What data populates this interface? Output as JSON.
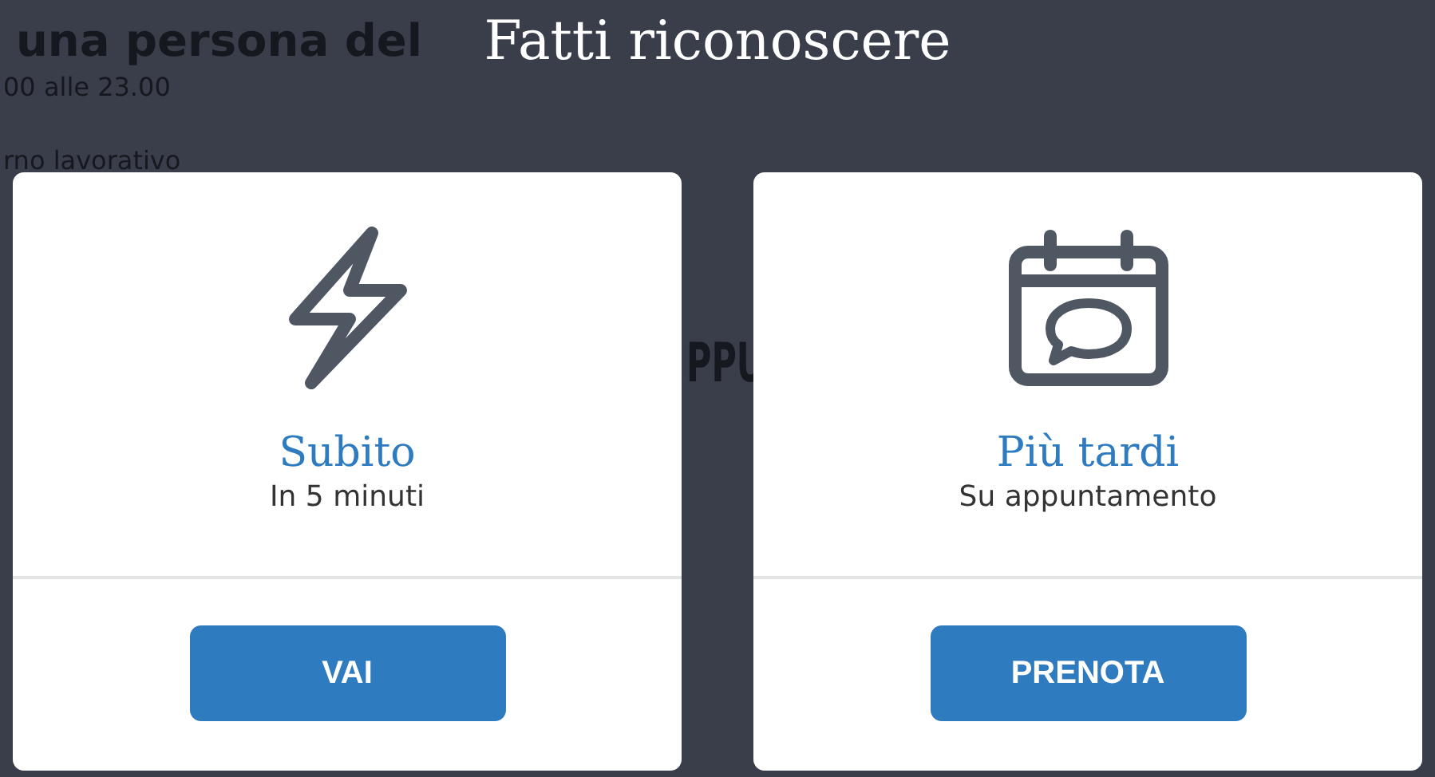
{
  "background_page": {
    "heading": "una persona del",
    "hours": "00 alle 23.00",
    "note": "rno lavorativo",
    "section_fragment": "PPU"
  },
  "modal": {
    "title": "Fatti riconoscere",
    "options": [
      {
        "kind": "now",
        "title": "Subito",
        "subtitle": "In 5 minuti",
        "button": "VAI"
      },
      {
        "kind": "later",
        "title": "Più tardi",
        "subtitle": "Su appuntamento",
        "button": "PRENOTA"
      }
    ]
  }
}
